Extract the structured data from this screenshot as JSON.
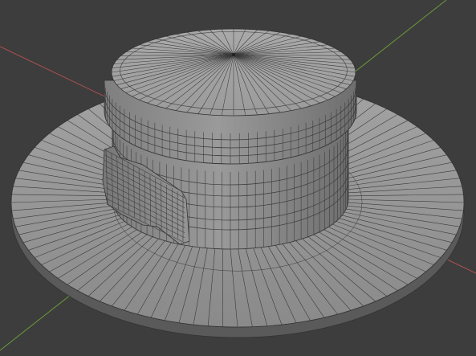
{
  "viewport": {
    "background": "#3d3d3d",
    "axis_x_color": "#b34f52",
    "axis_y_color": "#6a9b3a",
    "mesh_fill": "#8f8f8f",
    "mesh_fill_light": "#a8a8a8",
    "mesh_fill_dark": "#6f6f6f",
    "wire_color": "#3a3a3a",
    "object": "hat-mesh",
    "parts": [
      "brim",
      "crown-side",
      "crown-top",
      "bow-ribbon"
    ],
    "grid_axes_visible": true
  }
}
